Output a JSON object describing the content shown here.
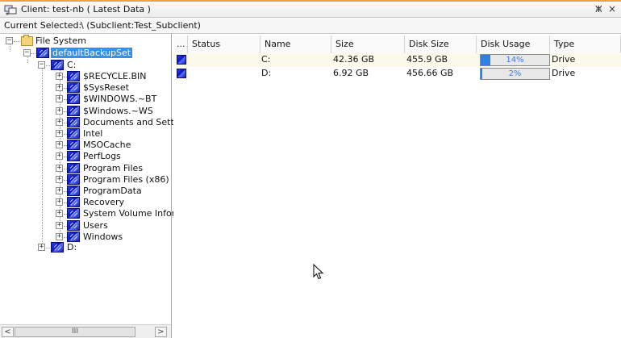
{
  "window": {
    "title": "Client: test-nb ( Latest Data )",
    "pin_icon": "pin-icon",
    "pin_glyph": "ⵥ",
    "close_glyph": "×"
  },
  "selection": {
    "label": "Current Selected:",
    "value": "\\ (Subclient:Test_Subclient)"
  },
  "tree": {
    "root": "File System",
    "backup_set": "defaultBackupSet",
    "drive_c": "C:",
    "folders": [
      "$RECYCLE.BIN",
      "$SysReset",
      "$WINDOWS.~BT",
      "$Windows.~WS",
      "Documents and Setti",
      "Intel",
      "MSOCache",
      "PerfLogs",
      "Program Files",
      "Program Files (x86)",
      "ProgramData",
      "Recovery",
      "System Volume Infor",
      "Users",
      "Windows"
    ],
    "drive_d": "D:",
    "expand_glyph": "+",
    "collapse_glyph": "−"
  },
  "scrollbar": {
    "left_glyph": "<",
    "right_glyph": ">",
    "thumb_glyph": "III"
  },
  "grid": {
    "columns": [
      "...",
      "Status",
      "Name",
      "Size",
      "Disk Size",
      "Disk Usage",
      "Type"
    ],
    "rows": [
      {
        "name": "C:",
        "size": "42.36 GB",
        "disk_size": "455.9 GB",
        "usage": 0.14,
        "usage_text": "14%",
        "type": "Drive"
      },
      {
        "name": "D:",
        "size": "6.92 GB",
        "disk_size": "456.66 GB",
        "usage": 0.02,
        "usage_text": "2%",
        "type": "Drive"
      }
    ]
  },
  "colors": {
    "selection": "#3a8ee6",
    "usage_fill": "#2f80e0",
    "row_highlight": "#fbf9ea"
  }
}
